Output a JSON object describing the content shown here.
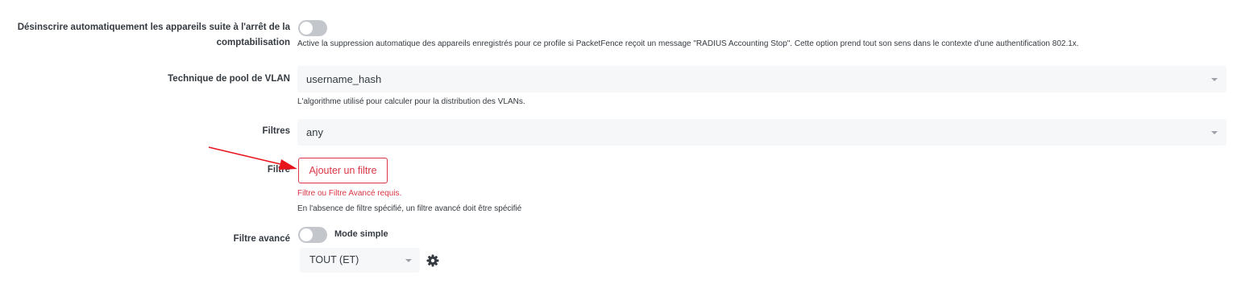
{
  "unregister_on_stop": {
    "label": "Désinscrire automatiquement les appareils suite à l'arrêt de la comptabilisation",
    "label_line1": "Désinscrire automatiquement les appareils suite à l'arrêt de la",
    "label_line2": "comptabilisation",
    "enabled": false,
    "help": "Active la suppression automatique des appareils enregistrés pour ce profile si PacketFence reçoit un message \"RADIUS Accounting Stop\". Cette option prend tout son sens dans le contexte d'une authentification 802.1x."
  },
  "vlan_pool": {
    "label": "Technique de pool de VLAN",
    "value": "username_hash",
    "help": "L'algorithme utilisé pour calculer pour la distribution des VLANs."
  },
  "filters": {
    "label": "Filtres",
    "value": "any"
  },
  "filter": {
    "label": "Filtre",
    "add_button": "Ajouter un filtre",
    "error": "Filtre ou Filtre Avancé requis.",
    "help": "En l'absence de filtre spécifié, un filtre avancé doit être spécifié"
  },
  "advanced_filter": {
    "label": "Filtre avancé",
    "mode_enabled": false,
    "mode_label": "Mode simple",
    "operator": "TOUT (ET)"
  },
  "colors": {
    "danger": "#dc3545",
    "annotation_arrow": "#e8141d",
    "toggle_off": "#c3c7cb",
    "input_bg": "#f5f7f9"
  },
  "icons": {
    "gear": "gear-icon",
    "caret": "chevron-down-icon"
  }
}
